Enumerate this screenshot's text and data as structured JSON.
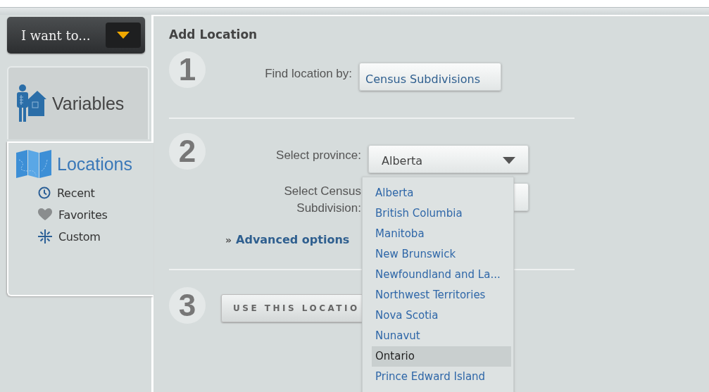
{
  "sidebar": {
    "menu_button": {
      "label": "I want to..."
    },
    "tabs": [
      {
        "label": "Variables",
        "kind": "variables",
        "selected": false
      },
      {
        "label": "Locations",
        "kind": "locations",
        "selected": true,
        "children": [
          {
            "label": "Recent",
            "kind": "recent"
          },
          {
            "label": "Favorites",
            "kind": "favorites"
          },
          {
            "label": "Custom",
            "kind": "custom"
          }
        ]
      }
    ]
  },
  "main": {
    "title": "Add Location",
    "step1": {
      "number": "1",
      "label": "Find location by:",
      "value": "Census Subdivisions"
    },
    "step2": {
      "number": "2",
      "province_label": "Select province:",
      "province_value": "Alberta",
      "expanded": true,
      "options": [
        {
          "label": "Alberta",
          "selected": false
        },
        {
          "label": "British Columbia",
          "selected": false
        },
        {
          "label": "Manitoba",
          "selected": false
        },
        {
          "label": "New Brunswick",
          "selected": false
        },
        {
          "label": "Newfoundland and La...",
          "selected": false
        },
        {
          "label": "Northwest Territories",
          "selected": false
        },
        {
          "label": "Nova Scotia",
          "selected": false
        },
        {
          "label": "Nunavut",
          "selected": false
        },
        {
          "label": "Ontario",
          "selected": true
        },
        {
          "label": "Prince Edward Island",
          "selected": false
        }
      ],
      "subdivision_label": [
        "Select Census",
        "Subdivision:"
      ],
      "advanced_prefix": "»",
      "advanced_link": "Advanced options"
    },
    "step3": {
      "number": "3",
      "button": "USE THIS LOCATIO"
    }
  }
}
